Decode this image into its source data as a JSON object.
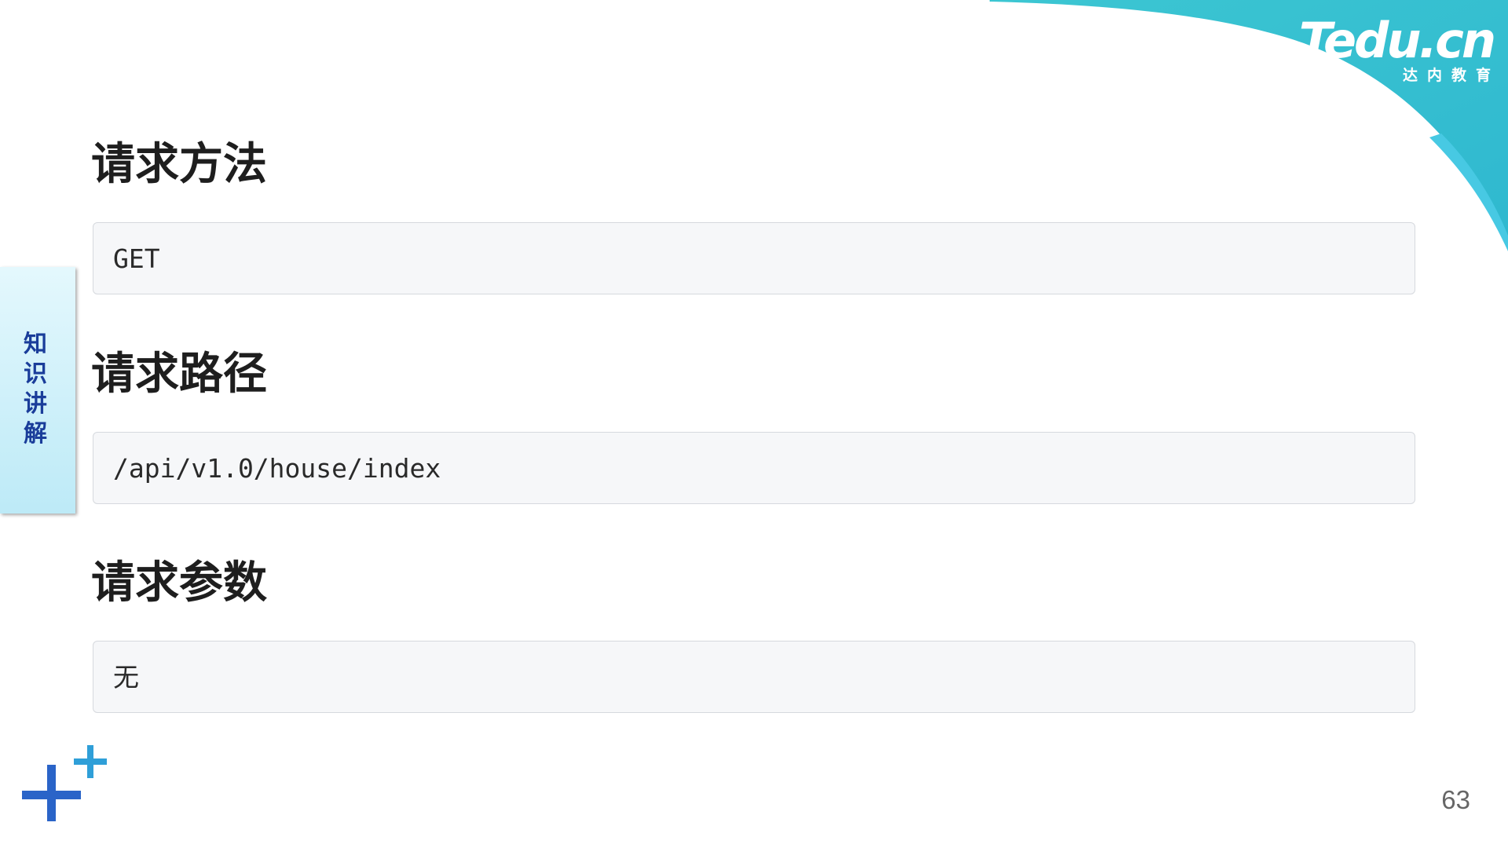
{
  "brand": {
    "wordmark": "Tedu.cn",
    "subtitle": "达内教育",
    "colors": {
      "dark_blue": "#2f5fc9",
      "teal": "#3cc6d2",
      "cyan": "#47c9e3"
    }
  },
  "side_tab": {
    "label": "知识讲解",
    "chars": [
      "知",
      "识",
      "讲",
      "解"
    ],
    "text_color": "#1a3d9a"
  },
  "sections": [
    {
      "heading": "请求方法",
      "content": "GET"
    },
    {
      "heading": "请求路径",
      "content": "/api/v1.0/house/index"
    },
    {
      "heading": "请求参数",
      "content": "无"
    }
  ],
  "decorations": {
    "plus_icons": [
      "large-plus-icon",
      "small-plus-icon"
    ],
    "plus_colors": [
      "#2a64c8",
      "#2f9fd8"
    ]
  },
  "page_number": "63"
}
